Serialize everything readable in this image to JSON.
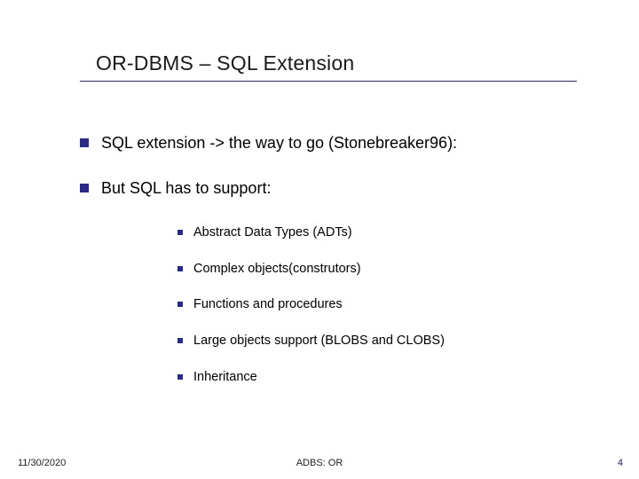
{
  "title": "OR-DBMS – SQL Extension",
  "points": [
    {
      "text": "SQL extension -> the way to go (Stonebreaker96):"
    },
    {
      "text": "But SQL has to support:"
    }
  ],
  "subpoints": [
    {
      "text": "Abstract Data Types (ADTs)"
    },
    {
      "text": "Complex objects(construtors)"
    },
    {
      "text": "Functions and procedures"
    },
    {
      "text": "Large objects support (BLOBS and CLOBS)"
    },
    {
      "text": "Inheritance"
    }
  ],
  "footer": {
    "date": "11/30/2020",
    "center": "ADBS: OR",
    "page": "4"
  }
}
